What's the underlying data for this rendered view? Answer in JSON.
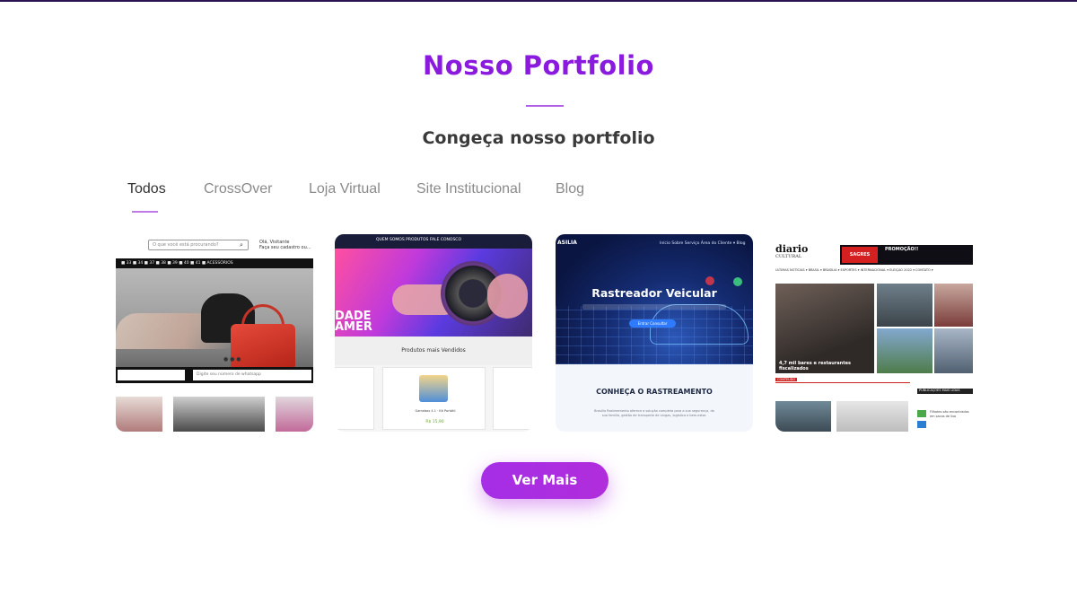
{
  "section": {
    "title": "Nosso Portfolio",
    "subtitle": "Congeça nosso portfolio"
  },
  "tabs": [
    {
      "label": "Todos",
      "active": true
    },
    {
      "label": "CrossOver",
      "active": false
    },
    {
      "label": "Loja Virtual",
      "active": false
    },
    {
      "label": "Site Institucional",
      "active": false
    },
    {
      "label": "Blog",
      "active": false
    }
  ],
  "portfolio": {
    "card1": {
      "search_placeholder": "O que você está procurando?",
      "user_greeting": "Olá, Visitante",
      "user_sub": "Faça seu cadastro ou...",
      "nav_items": "■ 33  ■ 34  ■ 37  ■ 38  ■ 39  ■ 40  ■ 41  ■ ACESSÓRIOS",
      "whatsapp_placeholder": "Digite seu número de whatsapp"
    },
    "card2": {
      "menu": "QUEM SOMOS   PRODUTOS   FALE CONOSCO",
      "hero_text": "DADE\nAMER",
      "section_title": "Produtos mais Vendidos",
      "price": "R$ 15,90"
    },
    "card3": {
      "logo": "ASILIA",
      "nav": "Início   Sobre   Serviço   Área do Cliente ▾   Blog",
      "hero_title": "Rastreador Veicular",
      "hero_button": "Entrar Consultar",
      "lower_title": "CONHEÇA O RASTREAMENTO",
      "lower_text": "Brasília Rastreamento oferece a solução completa para a sua segurança, da sua família, gestão de transporte de cargas, logística e bem-estar."
    },
    "card4": {
      "brand": "diario",
      "brand_sub": "CULTURAL",
      "ad_label": "SAGRES",
      "ad_promo": "PROMOÇÃO!!",
      "nav": "ÚLTIMAS NOTÍCIAS ▾  BRASIL ▾  BRASÍLIA ▾  ESPORTES ▾  INTERNACIONAL ▾  ELEIÇÃO 2022 ▾  CONTATO ▾",
      "main_caption": "4,7 mil bares e restaurantes fiscalizados",
      "section_label": "CONTEÚDO",
      "side_label": "PUBLICAÇÕES MAIS LIDAS",
      "side_text": "Filhotes são encontrados em sacos de lixo"
    }
  },
  "cta": {
    "label": "Ver Mais"
  },
  "colors": {
    "accent": "#8a1bde",
    "cta": "#a52ee6",
    "top_line": "#2a1352"
  }
}
